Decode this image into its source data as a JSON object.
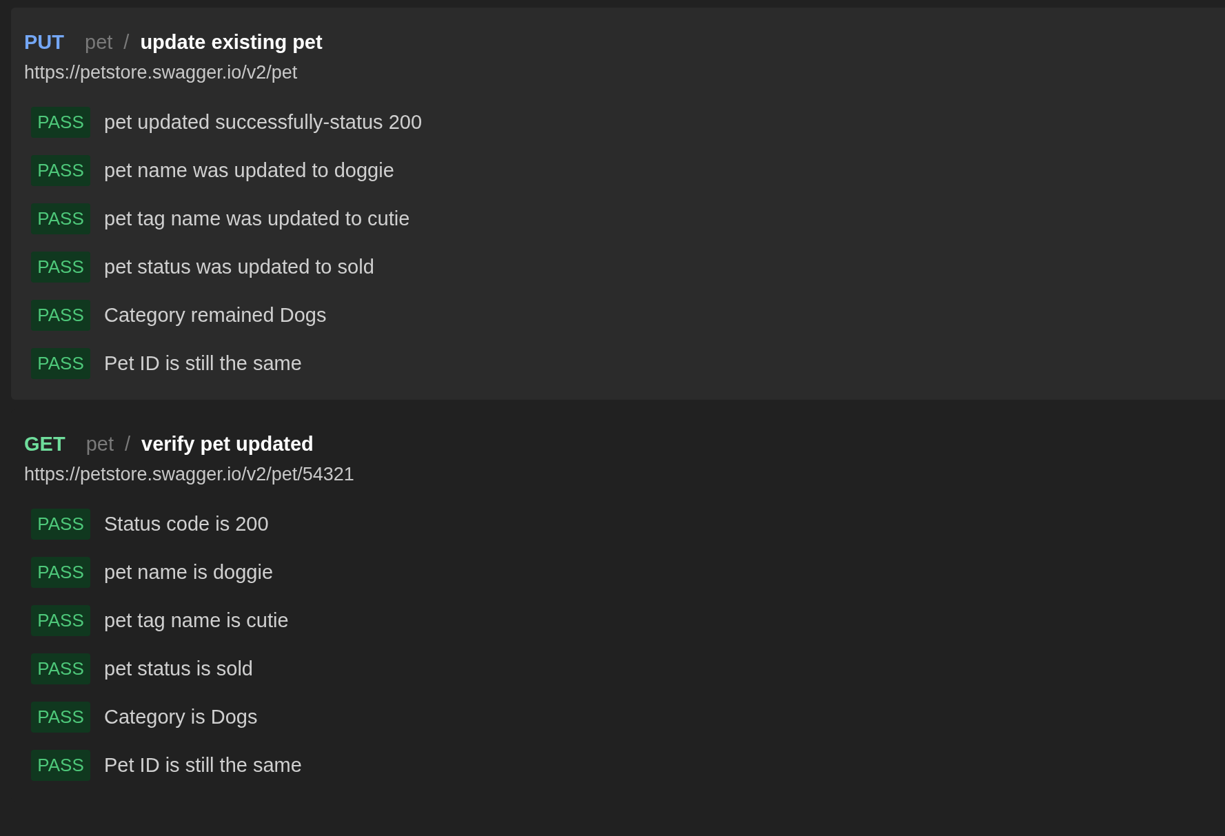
{
  "requests": [
    {
      "method": "PUT",
      "color": "#74a7f5",
      "collection": "pet",
      "separator": "/",
      "name": "update existing pet",
      "url": "https://petstore.swagger.io/v2/pet",
      "kind": "card",
      "tests": [
        {
          "kind": "pass",
          "status": "PASS",
          "text": "pet updated successfully-status 200"
        },
        {
          "kind": "pass",
          "status": "PASS",
          "text": "pet name was updated to doggie"
        },
        {
          "kind": "pass",
          "status": "PASS",
          "text": "pet tag name was updated to cutie"
        },
        {
          "kind": "pass",
          "status": "PASS",
          "text": "pet status was updated to sold"
        },
        {
          "kind": "pass",
          "status": "PASS",
          "text": "Category remained Dogs"
        },
        {
          "kind": "pass",
          "status": "PASS",
          "text": "Pet ID is still the same"
        }
      ]
    },
    {
      "method": "GET",
      "color": "#6fdd9c",
      "collection": "pet",
      "separator": "/",
      "name": "verify pet updated",
      "url": "https://petstore.swagger.io/v2/pet/54321",
      "kind": "plain",
      "tests": [
        {
          "kind": "pass",
          "status": "PASS",
          "text": "Status code is 200"
        },
        {
          "kind": "pass",
          "status": "PASS",
          "text": "pet name is doggie"
        },
        {
          "kind": "pass",
          "status": "PASS",
          "text": "pet tag name is cutie"
        },
        {
          "kind": "pass",
          "status": "PASS",
          "text": "pet status is sold"
        },
        {
          "kind": "pass",
          "status": "PASS",
          "text": "Category is Dogs"
        },
        {
          "kind": "pass",
          "status": "PASS",
          "text": "Pet ID is still the same"
        }
      ]
    }
  ]
}
